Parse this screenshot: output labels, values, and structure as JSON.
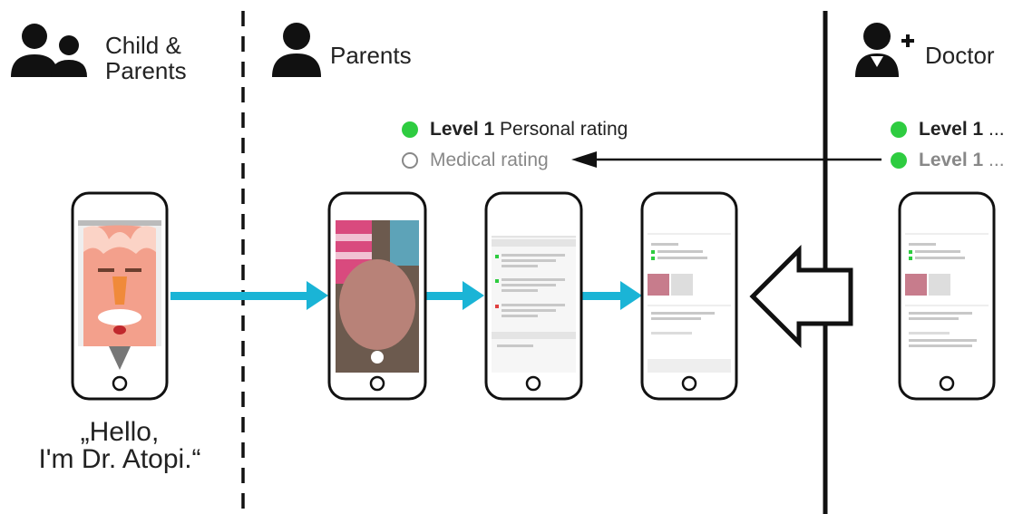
{
  "roles": {
    "child_parents_line1": "Child &",
    "child_parents_line2": "Parents",
    "parents": "Parents",
    "doctor": "Doctor"
  },
  "quote": {
    "line1": "„Hello,",
    "line2": "I'm Dr. Atopi.“"
  },
  "ratings": {
    "parents": {
      "level1_bold": "Level 1",
      "level1_text": " Personal rating",
      "medical_text": "Medical rating"
    },
    "doctor": {
      "row1_bold": "Level 1",
      "row1_text": " ...",
      "row2_bold": "Level 1",
      "row2_text": " ..."
    }
  },
  "colors": {
    "flow_arrow": "#1ab4d6",
    "status_green": "#2ecc40",
    "status_gray": "#888888",
    "icon": "#111111"
  },
  "icons": {
    "child_parents": "family-icon",
    "parents": "person-icon",
    "doctor": "doctor-add-icon"
  }
}
